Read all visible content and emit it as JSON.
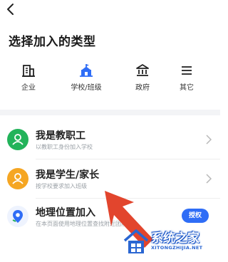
{
  "header": {
    "title": "选择加入的类型"
  },
  "type_tabs": [
    {
      "label": "企业",
      "icon": "building-icon",
      "active": false
    },
    {
      "label": "学校/班级",
      "icon": "school-icon",
      "active": true
    },
    {
      "label": "政府",
      "icon": "government-icon",
      "active": false
    },
    {
      "label": "其它",
      "icon": "menu-icon",
      "active": false
    }
  ],
  "options": [
    {
      "title": "我是教职工",
      "subtitle": "以教职工身份加入学校",
      "icon": "user-icon",
      "color": "#22b35a"
    },
    {
      "title": "我是学生/家长",
      "subtitle": "按学校要求加入班级",
      "icon": "user-icon",
      "color": "#f5a623"
    },
    {
      "title": "地理位置加入",
      "subtitle": "在本页面使用地理位置查找附近团队",
      "icon": "location-icon",
      "color": "#2f6df6",
      "button_label": "授权"
    }
  ],
  "watermark": {
    "name": "系统之家",
    "url": "XITONGZHIJIA.NET"
  },
  "colors": {
    "accent": "#2f6df6",
    "arrow": "#e2452d"
  }
}
